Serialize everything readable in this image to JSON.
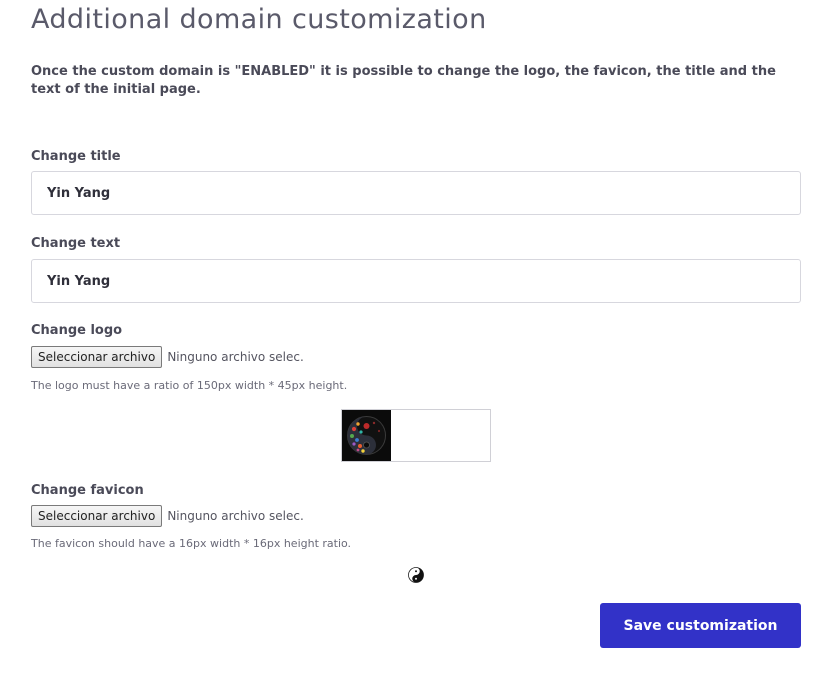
{
  "section": {
    "title": "Additional domain customization",
    "description": "Once the custom domain is \"ENABLED\" it is possible to change the logo, the favicon, the title and the text of the initial page."
  },
  "title_field": {
    "label": "Change title",
    "value": "Yin Yang"
  },
  "text_field": {
    "label": "Change text",
    "value": "Yin Yang"
  },
  "logo_field": {
    "label": "Change logo",
    "button_label": "Seleccionar archivo",
    "status": "Ninguno archivo selec.",
    "hint": "The logo must have a ratio of 150px width * 45px height.",
    "preview_icon": "yin-yang-logo-icon"
  },
  "favicon_field": {
    "label": "Change favicon",
    "button_label": "Seleccionar archivo",
    "status": "Ninguno archivo selec.",
    "hint": "The favicon should have a 16px width * 16px height ratio.",
    "preview_icon": "yin-yang-favicon-icon"
  },
  "actions": {
    "save_label": "Save customization"
  },
  "colors": {
    "primary_button": "#3232c8",
    "input_border": "#d7d7de",
    "logo_background": "#0b0b0b"
  }
}
